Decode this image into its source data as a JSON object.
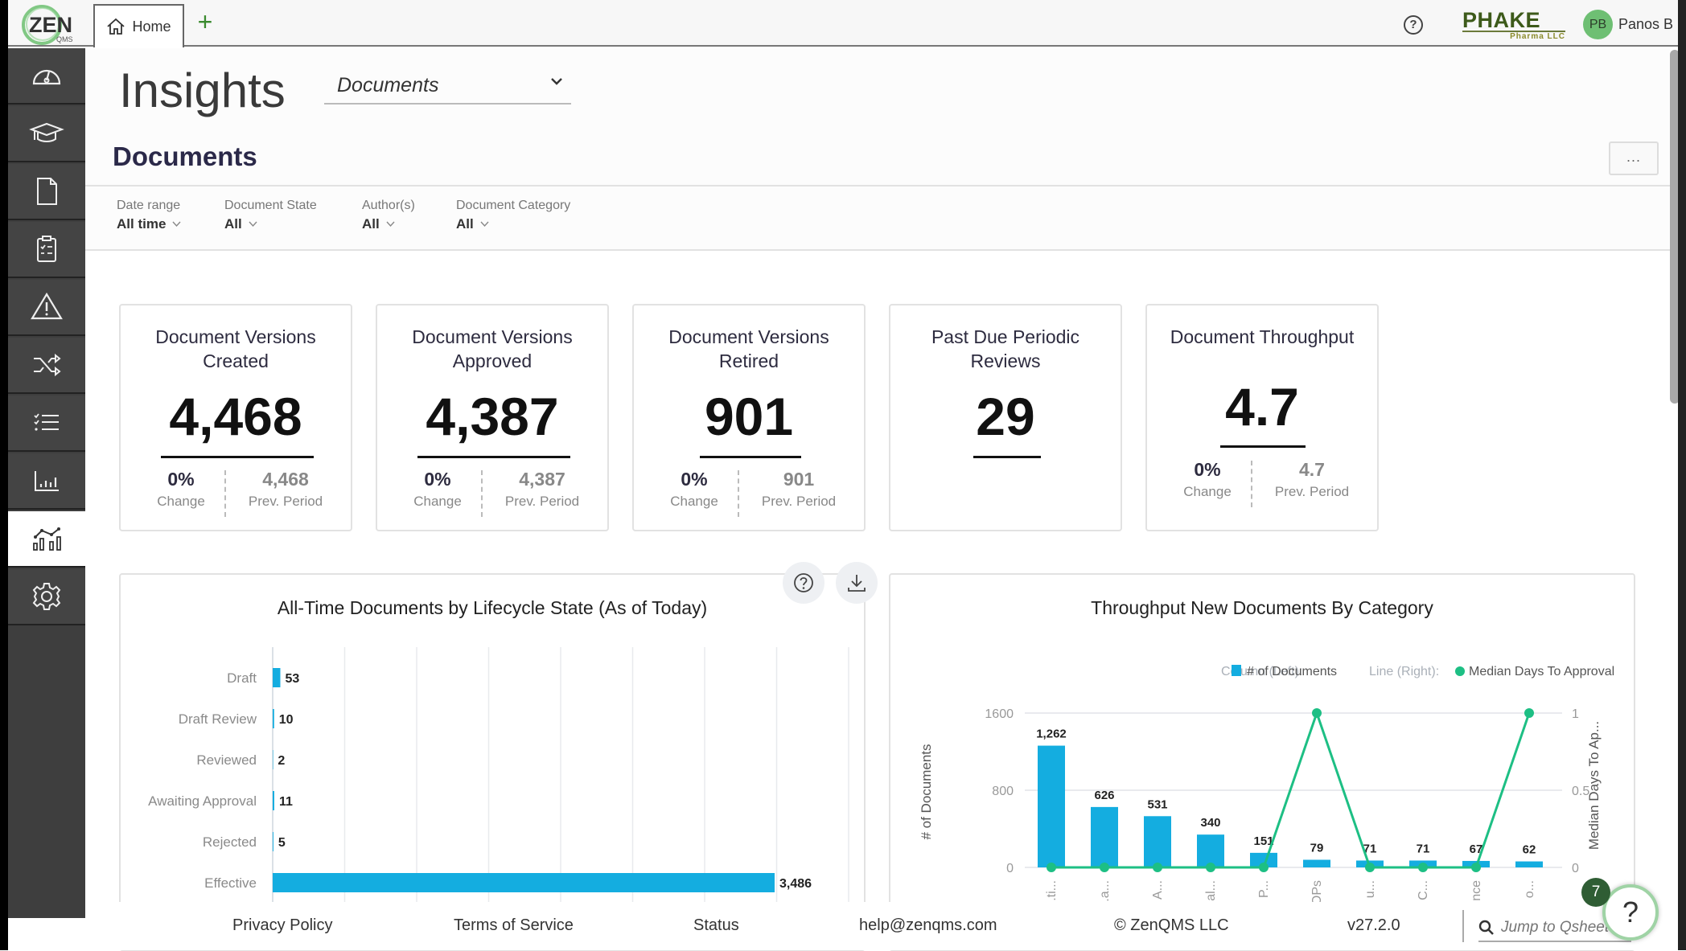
{
  "topbar": {
    "logo_text": "ZEN",
    "logo_sub": "QMS",
    "tabs": [
      {
        "label": "Home",
        "icon": "home-icon"
      }
    ],
    "add_tab_label": "+",
    "help_label": "?",
    "brand_name": "PHAKE",
    "brand_sub": "Pharma LLC",
    "user_initials": "PB",
    "user_name": "Panos B"
  },
  "sidebar": {
    "items": [
      {
        "id": "dashboard",
        "icon": "gauge-icon"
      },
      {
        "id": "training",
        "icon": "graduation-cap-icon"
      },
      {
        "id": "documents",
        "icon": "document-icon"
      },
      {
        "id": "audits",
        "icon": "clipboard-checklist-icon"
      },
      {
        "id": "issues",
        "icon": "warning-icon"
      },
      {
        "id": "change-control",
        "icon": "shuffle-icon"
      },
      {
        "id": "tasks",
        "icon": "checklist-icon"
      },
      {
        "id": "reports",
        "icon": "bar-chart-icon"
      },
      {
        "id": "insights",
        "icon": "insights-chart-icon",
        "active": true
      },
      {
        "id": "settings",
        "icon": "gear-icon"
      }
    ]
  },
  "page": {
    "title": "Insights",
    "view_select": {
      "value": "Documents"
    },
    "section_heading": "Documents",
    "more_label": "..."
  },
  "filters": [
    {
      "label": "Date range",
      "value": "All time"
    },
    {
      "label": "Document State",
      "value": "All"
    },
    {
      "label": "Author(s)",
      "value": "All"
    },
    {
      "label": "Document Category",
      "value": "All"
    }
  ],
  "kpis": [
    {
      "title": "Document Versions Created",
      "value": "4,468",
      "change": "0%",
      "change_label": "Change",
      "prev": "4,468",
      "prev_label": "Prev. Period"
    },
    {
      "title": "Document Versions Approved",
      "value": "4,387",
      "change": "0%",
      "change_label": "Change",
      "prev": "4,387",
      "prev_label": "Prev. Period"
    },
    {
      "title": "Document Versions Retired",
      "value": "901",
      "change": "0%",
      "change_label": "Change",
      "prev": "901",
      "prev_label": "Prev. Period"
    },
    {
      "title": "Past Due Periodic Reviews",
      "value": "29"
    },
    {
      "title": "Document Throughput",
      "value": "4.7",
      "change": "0%",
      "change_label": "Change",
      "prev": "4.7",
      "prev_label": "Prev. Period"
    }
  ],
  "chart_data": [
    {
      "type": "bar",
      "orientation": "horizontal",
      "title": "All-Time Documents by Lifecycle State (As of Today)",
      "categories": [
        "Draft",
        "Draft Review",
        "Reviewed",
        "Awaiting Approval",
        "Rejected",
        "Effective"
      ],
      "values": [
        53,
        10,
        2,
        11,
        5,
        3486
      ],
      "value_labels": [
        "53",
        "10",
        "2",
        "11",
        "5",
        "3,486"
      ],
      "xlim": [
        0,
        4000
      ],
      "grid_step": 500,
      "grid": true,
      "color": "#14ade0"
    },
    {
      "type": "bar",
      "title": "Throughput New Documents By Category",
      "categories": [
        "...ti...",
        "...a...",
        "A...",
        "al...",
        "P...",
        "OPs",
        "u...",
        "C...",
        "nce",
        "o..."
      ],
      "legend": {
        "placement": "top-right",
        "column_prefix": "Column (Left):",
        "line_prefix": "Line (Right):"
      },
      "series": [
        {
          "name": "# of Documents",
          "type": "bar",
          "axis": "left",
          "color": "#14ade0",
          "values": [
            1262,
            626,
            531,
            340,
            151,
            79,
            71,
            71,
            67,
            62
          ],
          "value_labels": [
            "1,262",
            "626",
            "531",
            "340",
            "151",
            "79",
            "71",
            "71",
            "67",
            "62"
          ]
        },
        {
          "name": "Median Days To Approval",
          "type": "line",
          "axis": "right",
          "color": "#1dbf84",
          "values": [
            0,
            0,
            0,
            0,
            0,
            1,
            0,
            0,
            0,
            1
          ]
        }
      ],
      "ylabel_left": "# of Documents",
      "ylabel_right": "Median Days To Ap...",
      "ylim_left": [
        0,
        1600
      ],
      "yticks_left": [
        "0",
        "800",
        "1600"
      ],
      "ylim_right": [
        0,
        1
      ],
      "yticks_right": [
        "0",
        "0.5",
        "1"
      ],
      "grid": true
    }
  ],
  "chart_buttons": {
    "help": "?",
    "download": "download"
  },
  "footer": {
    "links": [
      "Privacy Policy",
      "Terms of Service",
      "Status",
      "help@zenqms.com",
      "© ZenQMS LLC",
      "v27.2.0"
    ],
    "jump_placeholder": "Jump to Qsheet",
    "help_badge": "7",
    "help_label": "?"
  }
}
